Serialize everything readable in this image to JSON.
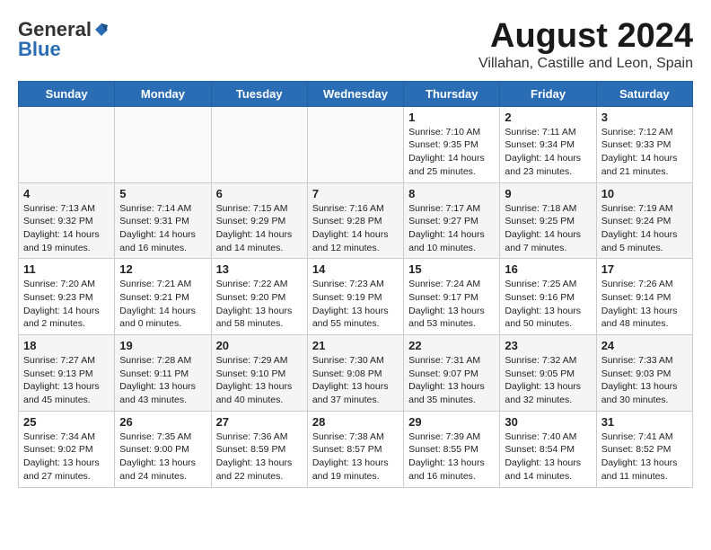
{
  "header": {
    "logo_general": "General",
    "logo_blue": "Blue",
    "month_year": "August 2024",
    "location": "Villahan, Castille and Leon, Spain"
  },
  "days_of_week": [
    "Sunday",
    "Monday",
    "Tuesday",
    "Wednesday",
    "Thursday",
    "Friday",
    "Saturday"
  ],
  "weeks": [
    [
      {
        "day": "",
        "info": ""
      },
      {
        "day": "",
        "info": ""
      },
      {
        "day": "",
        "info": ""
      },
      {
        "day": "",
        "info": ""
      },
      {
        "day": "1",
        "info": "Sunrise: 7:10 AM\nSunset: 9:35 PM\nDaylight: 14 hours and 25 minutes."
      },
      {
        "day": "2",
        "info": "Sunrise: 7:11 AM\nSunset: 9:34 PM\nDaylight: 14 hours and 23 minutes."
      },
      {
        "day": "3",
        "info": "Sunrise: 7:12 AM\nSunset: 9:33 PM\nDaylight: 14 hours and 21 minutes."
      }
    ],
    [
      {
        "day": "4",
        "info": "Sunrise: 7:13 AM\nSunset: 9:32 PM\nDaylight: 14 hours and 19 minutes."
      },
      {
        "day": "5",
        "info": "Sunrise: 7:14 AM\nSunset: 9:31 PM\nDaylight: 14 hours and 16 minutes."
      },
      {
        "day": "6",
        "info": "Sunrise: 7:15 AM\nSunset: 9:29 PM\nDaylight: 14 hours and 14 minutes."
      },
      {
        "day": "7",
        "info": "Sunrise: 7:16 AM\nSunset: 9:28 PM\nDaylight: 14 hours and 12 minutes."
      },
      {
        "day": "8",
        "info": "Sunrise: 7:17 AM\nSunset: 9:27 PM\nDaylight: 14 hours and 10 minutes."
      },
      {
        "day": "9",
        "info": "Sunrise: 7:18 AM\nSunset: 9:25 PM\nDaylight: 14 hours and 7 minutes."
      },
      {
        "day": "10",
        "info": "Sunrise: 7:19 AM\nSunset: 9:24 PM\nDaylight: 14 hours and 5 minutes."
      }
    ],
    [
      {
        "day": "11",
        "info": "Sunrise: 7:20 AM\nSunset: 9:23 PM\nDaylight: 14 hours and 2 minutes."
      },
      {
        "day": "12",
        "info": "Sunrise: 7:21 AM\nSunset: 9:21 PM\nDaylight: 14 hours and 0 minutes."
      },
      {
        "day": "13",
        "info": "Sunrise: 7:22 AM\nSunset: 9:20 PM\nDaylight: 13 hours and 58 minutes."
      },
      {
        "day": "14",
        "info": "Sunrise: 7:23 AM\nSunset: 9:19 PM\nDaylight: 13 hours and 55 minutes."
      },
      {
        "day": "15",
        "info": "Sunrise: 7:24 AM\nSunset: 9:17 PM\nDaylight: 13 hours and 53 minutes."
      },
      {
        "day": "16",
        "info": "Sunrise: 7:25 AM\nSunset: 9:16 PM\nDaylight: 13 hours and 50 minutes."
      },
      {
        "day": "17",
        "info": "Sunrise: 7:26 AM\nSunset: 9:14 PM\nDaylight: 13 hours and 48 minutes."
      }
    ],
    [
      {
        "day": "18",
        "info": "Sunrise: 7:27 AM\nSunset: 9:13 PM\nDaylight: 13 hours and 45 minutes."
      },
      {
        "day": "19",
        "info": "Sunrise: 7:28 AM\nSunset: 9:11 PM\nDaylight: 13 hours and 43 minutes."
      },
      {
        "day": "20",
        "info": "Sunrise: 7:29 AM\nSunset: 9:10 PM\nDaylight: 13 hours and 40 minutes."
      },
      {
        "day": "21",
        "info": "Sunrise: 7:30 AM\nSunset: 9:08 PM\nDaylight: 13 hours and 37 minutes."
      },
      {
        "day": "22",
        "info": "Sunrise: 7:31 AM\nSunset: 9:07 PM\nDaylight: 13 hours and 35 minutes."
      },
      {
        "day": "23",
        "info": "Sunrise: 7:32 AM\nSunset: 9:05 PM\nDaylight: 13 hours and 32 minutes."
      },
      {
        "day": "24",
        "info": "Sunrise: 7:33 AM\nSunset: 9:03 PM\nDaylight: 13 hours and 30 minutes."
      }
    ],
    [
      {
        "day": "25",
        "info": "Sunrise: 7:34 AM\nSunset: 9:02 PM\nDaylight: 13 hours and 27 minutes."
      },
      {
        "day": "26",
        "info": "Sunrise: 7:35 AM\nSunset: 9:00 PM\nDaylight: 13 hours and 24 minutes."
      },
      {
        "day": "27",
        "info": "Sunrise: 7:36 AM\nSunset: 8:59 PM\nDaylight: 13 hours and 22 minutes."
      },
      {
        "day": "28",
        "info": "Sunrise: 7:38 AM\nSunset: 8:57 PM\nDaylight: 13 hours and 19 minutes."
      },
      {
        "day": "29",
        "info": "Sunrise: 7:39 AM\nSunset: 8:55 PM\nDaylight: 13 hours and 16 minutes."
      },
      {
        "day": "30",
        "info": "Sunrise: 7:40 AM\nSunset: 8:54 PM\nDaylight: 13 hours and 14 minutes."
      },
      {
        "day": "31",
        "info": "Sunrise: 7:41 AM\nSunset: 8:52 PM\nDaylight: 13 hours and 11 minutes."
      }
    ]
  ]
}
